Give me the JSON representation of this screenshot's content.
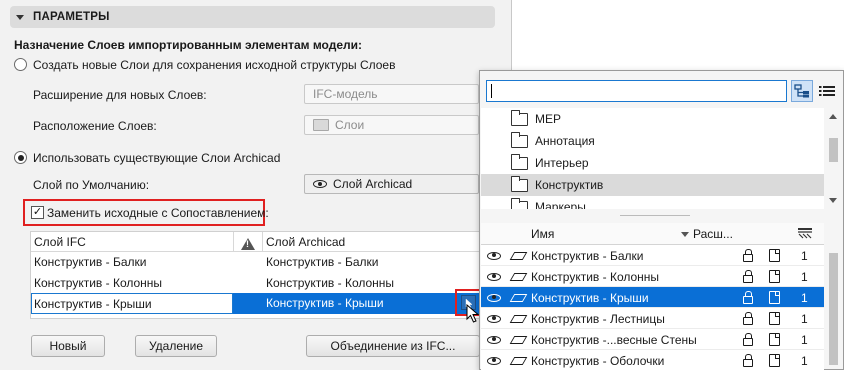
{
  "section": {
    "title": "ПАРАМЕТРЫ"
  },
  "assign_title": "Назначение Слоев импортированным элементам модели:",
  "radio_create": "Создать новые Слои для сохранения исходной структуры Слоев",
  "ext_label": "Расширение для новых Слоев:",
  "ext_value": "IFC-модель",
  "location_label": "Расположение Слоев:",
  "location_value": "Слои",
  "radio_existing": "Использовать существующие Слои Archicad",
  "default_label": "Слой по Умолчанию:",
  "default_value": "Слой Archicad",
  "replace_label": "Заменить исходные с Сопоставлением:",
  "mapping": {
    "col_ifc": "Слой IFC",
    "col_archicad": "Слой Archicad",
    "rows": [
      {
        "ifc": "Конструктив - Балки",
        "archicad": "Конструктив - Балки"
      },
      {
        "ifc": "Конструктив - Колонны",
        "archicad": "Конструктив - Колонны"
      },
      {
        "ifc": "Конструктив - Крыши",
        "archicad": "Конструктив - Крыши"
      }
    ]
  },
  "buttons": {
    "new": "Новый",
    "delete": "Удаление",
    "merge": "Объединение из IFC..."
  },
  "popup": {
    "search_value": "",
    "folders": [
      "MEP",
      "Аннотация",
      "Интерьер",
      "Конструктив",
      "Маркеры"
    ],
    "header": {
      "name": "Имя",
      "ext": "Расш..."
    },
    "layers": [
      {
        "name": "Конструктив - Балки",
        "num": "1"
      },
      {
        "name": "Конструктив - Колонны",
        "num": "1"
      },
      {
        "name": "Конструктив - Крыши",
        "num": "1"
      },
      {
        "name": "Конструктив - Лестницы",
        "num": "1"
      },
      {
        "name": "Конструктив -...весные Стены",
        "num": "1"
      },
      {
        "name": "Конструктив - Оболочки",
        "num": "1"
      }
    ]
  },
  "colors": {
    "selection": "#0a6fd6",
    "highlight": "#e02020",
    "focus": "#1a78d0"
  }
}
